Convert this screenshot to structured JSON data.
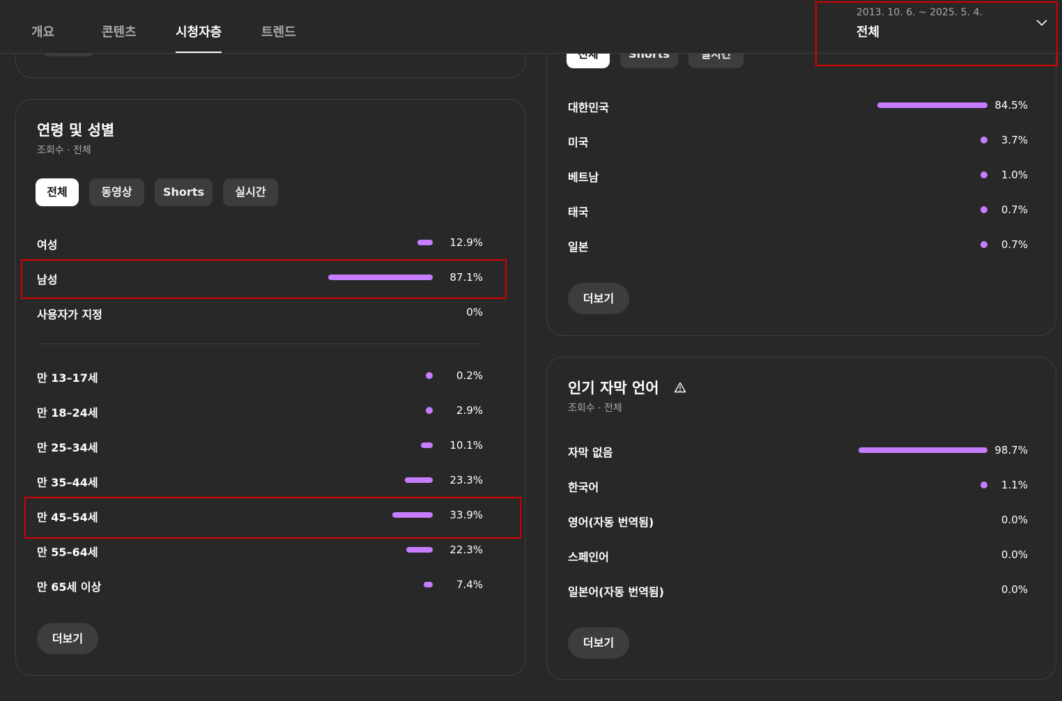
{
  "nav": {
    "tabs": [
      "개요",
      "콘텐츠",
      "시청자층",
      "트렌드"
    ],
    "active_tab": "시청자층"
  },
  "date_picker": {
    "range": "2013. 10. 6. ~ 2025. 5. 4.",
    "value": "전체"
  },
  "geo_card": {
    "chips": [
      "전체",
      "Shorts",
      "실시간"
    ],
    "rows": [
      {
        "label": "대한민국",
        "value": "84.5%",
        "pct": 84.5
      },
      {
        "label": "미국",
        "value": "3.7%",
        "pct": 3.7
      },
      {
        "label": "베트남",
        "value": "1.0%",
        "pct": 1.0
      },
      {
        "label": "태국",
        "value": "0.7%",
        "pct": 0.7
      },
      {
        "label": "일본",
        "value": "0.7%",
        "pct": 0.7
      }
    ],
    "more_label": "더보기"
  },
  "age_gender_card": {
    "title": "연령 및 성별",
    "subtitle": "조회수 · 전체",
    "chips": [
      "전체",
      "동영상",
      "Shorts",
      "실시간"
    ],
    "gender_rows": [
      {
        "label": "여성",
        "value": "12.9%",
        "pct": 12.9
      },
      {
        "label": "남성",
        "value": "87.1%",
        "pct": 87.1
      },
      {
        "label": "사용자가 지정",
        "value": "0%",
        "pct": 0
      }
    ],
    "age_rows": [
      {
        "label": "만 13–17세",
        "value": "0.2%",
        "pct": 0.2
      },
      {
        "label": "만 18–24세",
        "value": "2.9%",
        "pct": 2.9
      },
      {
        "label": "만 25–34세",
        "value": "10.1%",
        "pct": 10.1
      },
      {
        "label": "만 35–44세",
        "value": "23.3%",
        "pct": 23.3
      },
      {
        "label": "만 45–54세",
        "value": "33.9%",
        "pct": 33.9
      },
      {
        "label": "만 55–64세",
        "value": "22.3%",
        "pct": 22.3
      },
      {
        "label": "만 65세 이상",
        "value": "7.4%",
        "pct": 7.4
      }
    ],
    "more_label": "더보기"
  },
  "subtitle_card": {
    "title": "인기 자막 언어",
    "subtitle": "조회수 · 전체",
    "rows": [
      {
        "label": "자막 없음",
        "value": "98.7%",
        "pct": 98.7
      },
      {
        "label": "한국어",
        "value": "1.1%",
        "pct": 1.1
      },
      {
        "label": "영어(자동 번역됨)",
        "value": "0.0%",
        "pct": 0
      },
      {
        "label": "스페인어",
        "value": "0.0%",
        "pct": 0
      },
      {
        "label": "일본어(자동 번역됨)",
        "value": "0.0%",
        "pct": 0
      }
    ],
    "more_label": "더보기"
  },
  "colors": {
    "bar": "#c77dff",
    "highlight": "#d40000",
    "background": "#282828"
  }
}
